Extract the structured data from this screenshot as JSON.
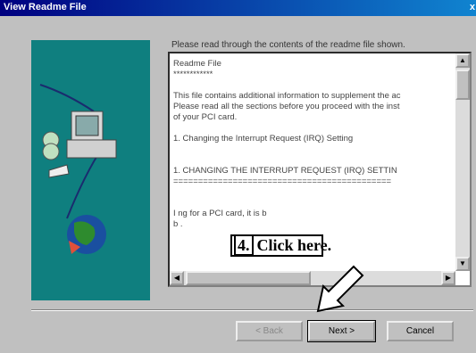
{
  "window": {
    "title": "View Readme File",
    "close_label": "x"
  },
  "instruction": "Please read through the contents of the readme file shown.",
  "readme": {
    "lines": [
      "Readme File",
      "************",
      "",
      "This file contains additional information to supplement the ac",
      "Please read all the sections before you proceed with the inst",
      "of your PCI card.",
      "",
      "   1.  Changing the Interrupt Request (IRQ) Setting",
      "",
      "",
      "1.  CHANGING THE INTERRUPT REQUEST (IRQ) SETTIN",
      "============================================",
      "",
      "",
      "I                                     ng for a PCI card, it is b",
      "b                                     ."
    ]
  },
  "buttons": {
    "back": "< Back",
    "next": "Next >",
    "cancel": "Cancel"
  },
  "callout": {
    "number": "4.",
    "text": "Click here."
  },
  "colors": {
    "panel": "#0f7f7f",
    "titlebar": "#000080"
  }
}
